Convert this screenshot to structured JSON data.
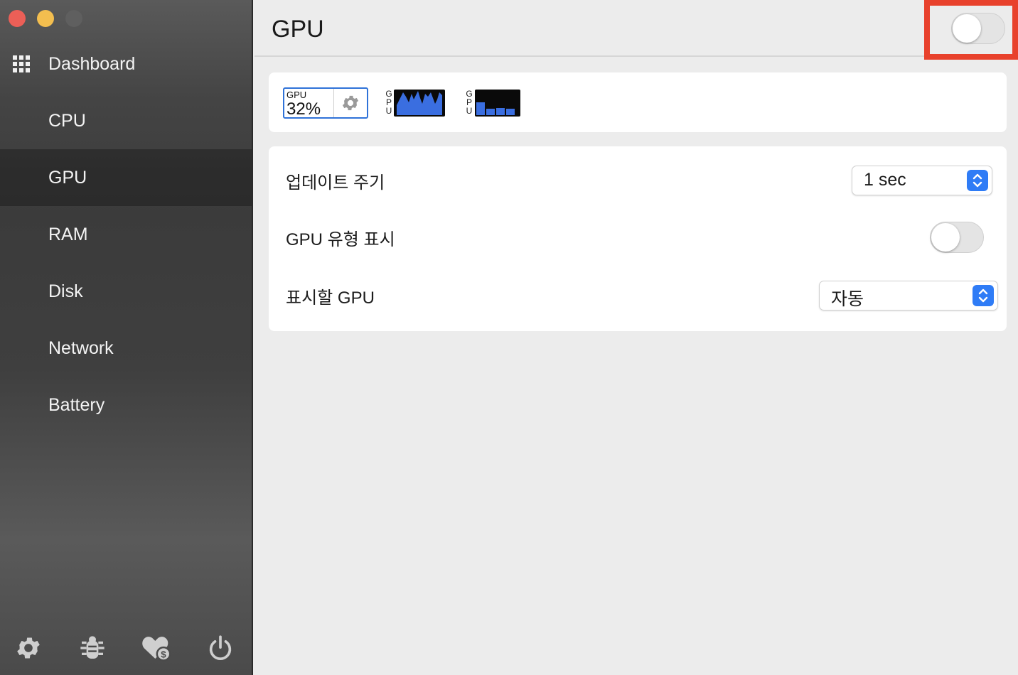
{
  "window": {
    "controls": [
      "close",
      "minimize",
      "maximize"
    ]
  },
  "sidebar": {
    "items": [
      {
        "label": "Dashboard",
        "icon": "grid-icon"
      },
      {
        "label": "CPU"
      },
      {
        "label": "GPU",
        "active": true
      },
      {
        "label": "RAM"
      },
      {
        "label": "Disk"
      },
      {
        "label": "Network"
      },
      {
        "label": "Battery"
      }
    ],
    "footer_icons": [
      "gear-icon",
      "bug-icon",
      "heart-dollar-icon",
      "power-icon"
    ]
  },
  "header": {
    "title": "GPU",
    "enabled": false
  },
  "widgets": {
    "mini": {
      "label": "GPU",
      "value": "32%",
      "icon": "gear-icon"
    },
    "line_chart": {
      "label": [
        "G",
        "P",
        "U"
      ]
    },
    "bar_chart": {
      "label": [
        "G",
        "P",
        "U"
      ]
    }
  },
  "settings": {
    "update_interval": {
      "label": "업데이트 주기",
      "value": "1 sec"
    },
    "show_gpu_type": {
      "label": "GPU 유형 표시",
      "enabled": false
    },
    "gpu_to_show": {
      "label": "표시할 GPU",
      "value": "자동"
    }
  },
  "colors": {
    "accent": "#2f7cf6",
    "highlight": "#e8412c",
    "chart_fill": "#3a6ee0",
    "traffic_close": "#ec5f57",
    "traffic_min": "#f3be4f"
  }
}
